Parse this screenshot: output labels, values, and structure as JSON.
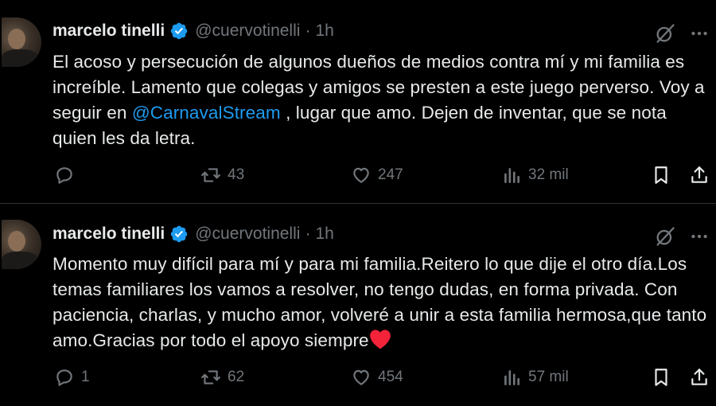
{
  "tweets": [
    {
      "author": {
        "name": "marcelo tinelli",
        "handle": "@cuervotinelli",
        "separator": "·",
        "time": "1h"
      },
      "text_before": "El acoso y persecución de algunos dueños de medios contra mí y mi familia es increíble. Lamento que colegas y amigos se presten a este juego perverso. Voy a seguir en ",
      "mention": "@CarnavalStream",
      "text_after": " , lugar que amo. Dejen de inventar, que se nota quien les da letra.",
      "stats": {
        "replies": "",
        "retweets": "43",
        "likes": "247",
        "views": "32 mil"
      }
    },
    {
      "author": {
        "name": "marcelo tinelli",
        "handle": "@cuervotinelli",
        "separator": "·",
        "time": "1h"
      },
      "text": "Momento muy difícil para mí y para mi familia.Reitero lo que dije el otro día.Los temas familiares los vamos a resolver, no tengo dudas, en forma privada. Con paciencia, charlas, y mucho amor, volveré a unir a esta familia hermosa,que tanto amo.Gracias por todo el apoyo siempre",
      "emoji": "red-heart",
      "stats": {
        "replies": "1",
        "retweets": "62",
        "likes": "454",
        "views": "57 mil"
      }
    }
  ],
  "icons": [
    "verified-badge-icon",
    "grok-icon",
    "more-icon",
    "reply-icon",
    "retweet-icon",
    "like-icon",
    "views-icon",
    "bookmark-icon",
    "share-icon"
  ],
  "colors": {
    "background": "#000000",
    "text": "#e7e9ea",
    "secondary": "#71767b",
    "accent": "#1d9bf0",
    "heart": "#f91880",
    "divider": "#2f3336"
  }
}
